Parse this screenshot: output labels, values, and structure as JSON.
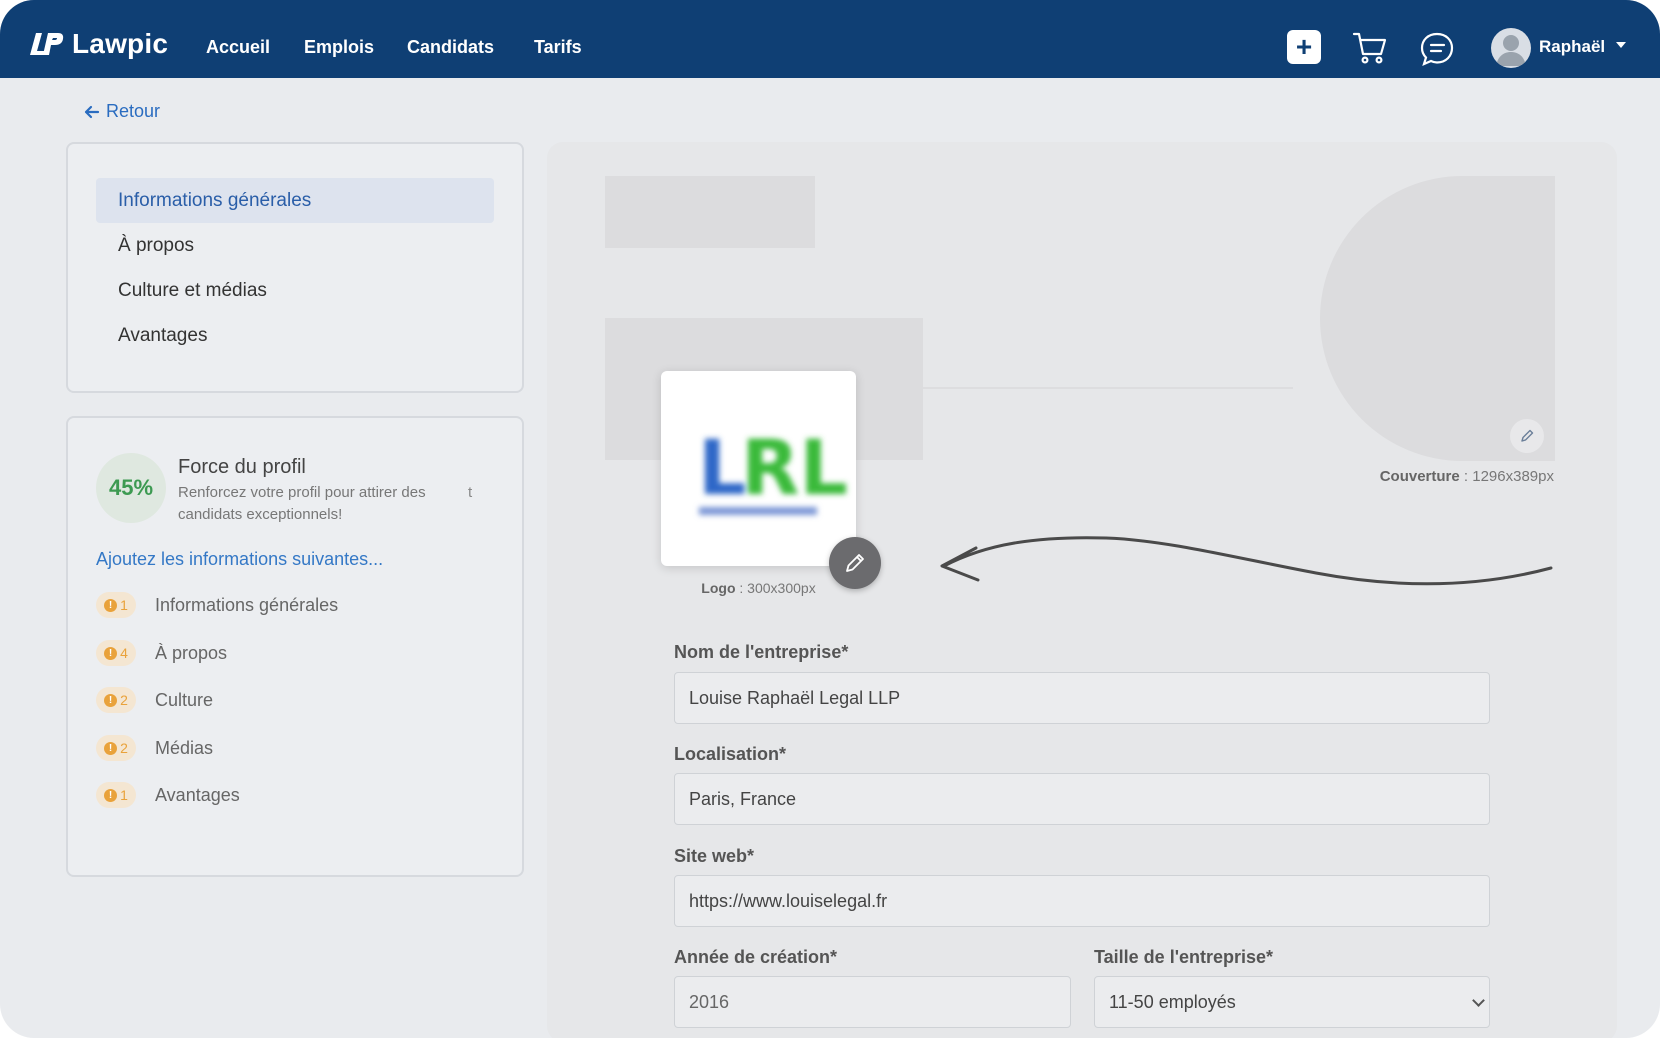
{
  "header": {
    "brand": "Lawpic",
    "nav": [
      "Accueil",
      "Emplois",
      "Candidats",
      "Tarifs"
    ],
    "plus_label": "+",
    "user_name": "Raphaël",
    "icons": [
      "plus-icon",
      "cart-icon",
      "chat-icon",
      "avatar-icon",
      "caret-down-icon"
    ]
  },
  "back": {
    "label": "Retour"
  },
  "sidebar": {
    "menu": [
      {
        "label": "Informations générales",
        "active": true
      },
      {
        "label": "À propos",
        "active": false
      },
      {
        "label": "Culture et médias",
        "active": false
      },
      {
        "label": "Avantages",
        "active": false
      }
    ]
  },
  "profile_strength": {
    "percent_label": "45%",
    "percent": 45,
    "title": "Force du profil",
    "description": "Renforcez votre profil pour attirer des candidats exceptionnels!",
    "stray_char": "t",
    "add_info_label": "Ajoutez les informations suivantes...",
    "items": [
      {
        "count": "1",
        "label": "Informations générales"
      },
      {
        "count": "4",
        "label": "À propos"
      },
      {
        "count": "2",
        "label": "Culture"
      },
      {
        "count": "2",
        "label": "Médias"
      },
      {
        "count": "1",
        "label": "Avantages"
      }
    ]
  },
  "media": {
    "cover_label": "Couverture",
    "cover_size": " : 1296x389px",
    "logo_label": "Logo",
    "logo_size": " : 300x300px",
    "logo_text": "LRL",
    "logo_subtext": "LOUISE RAPHAËL"
  },
  "form": {
    "company_name": {
      "label": "Nom de l'entreprise*",
      "value": "Louise Raphaël Legal LLP"
    },
    "location": {
      "label": "Localisation*",
      "value": "Paris, France"
    },
    "website": {
      "label": "Site web*",
      "value": "https://www.louiselegal.fr"
    },
    "year": {
      "label": "Année de création*",
      "value": "2016"
    },
    "size": {
      "label": "Taille de l'entreprise*",
      "value": "11-50 employés"
    }
  },
  "colors": {
    "navbar": "#0f3f74",
    "accent_blue": "#2a6cc0",
    "success_green": "#3d9a52",
    "warning_orange": "#e9a23b"
  }
}
